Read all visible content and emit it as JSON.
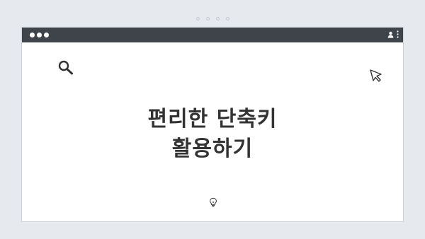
{
  "pager": {
    "dots": [
      "",
      "",
      "",
      "",
      ""
    ]
  },
  "window": {
    "titlebar": {
      "color": "#3f444a",
      "controls": [
        "dot",
        "dot",
        "dot"
      ],
      "right_icons": [
        "user-icon",
        "more-vertical-icon"
      ]
    },
    "content": {
      "icons": [
        "search-icon",
        "cursor-arrow-icon",
        "lightbulb-icon"
      ],
      "headline_lines": [
        "편리한 단축키",
        "활용하기"
      ],
      "text_color": "#333333"
    }
  }
}
